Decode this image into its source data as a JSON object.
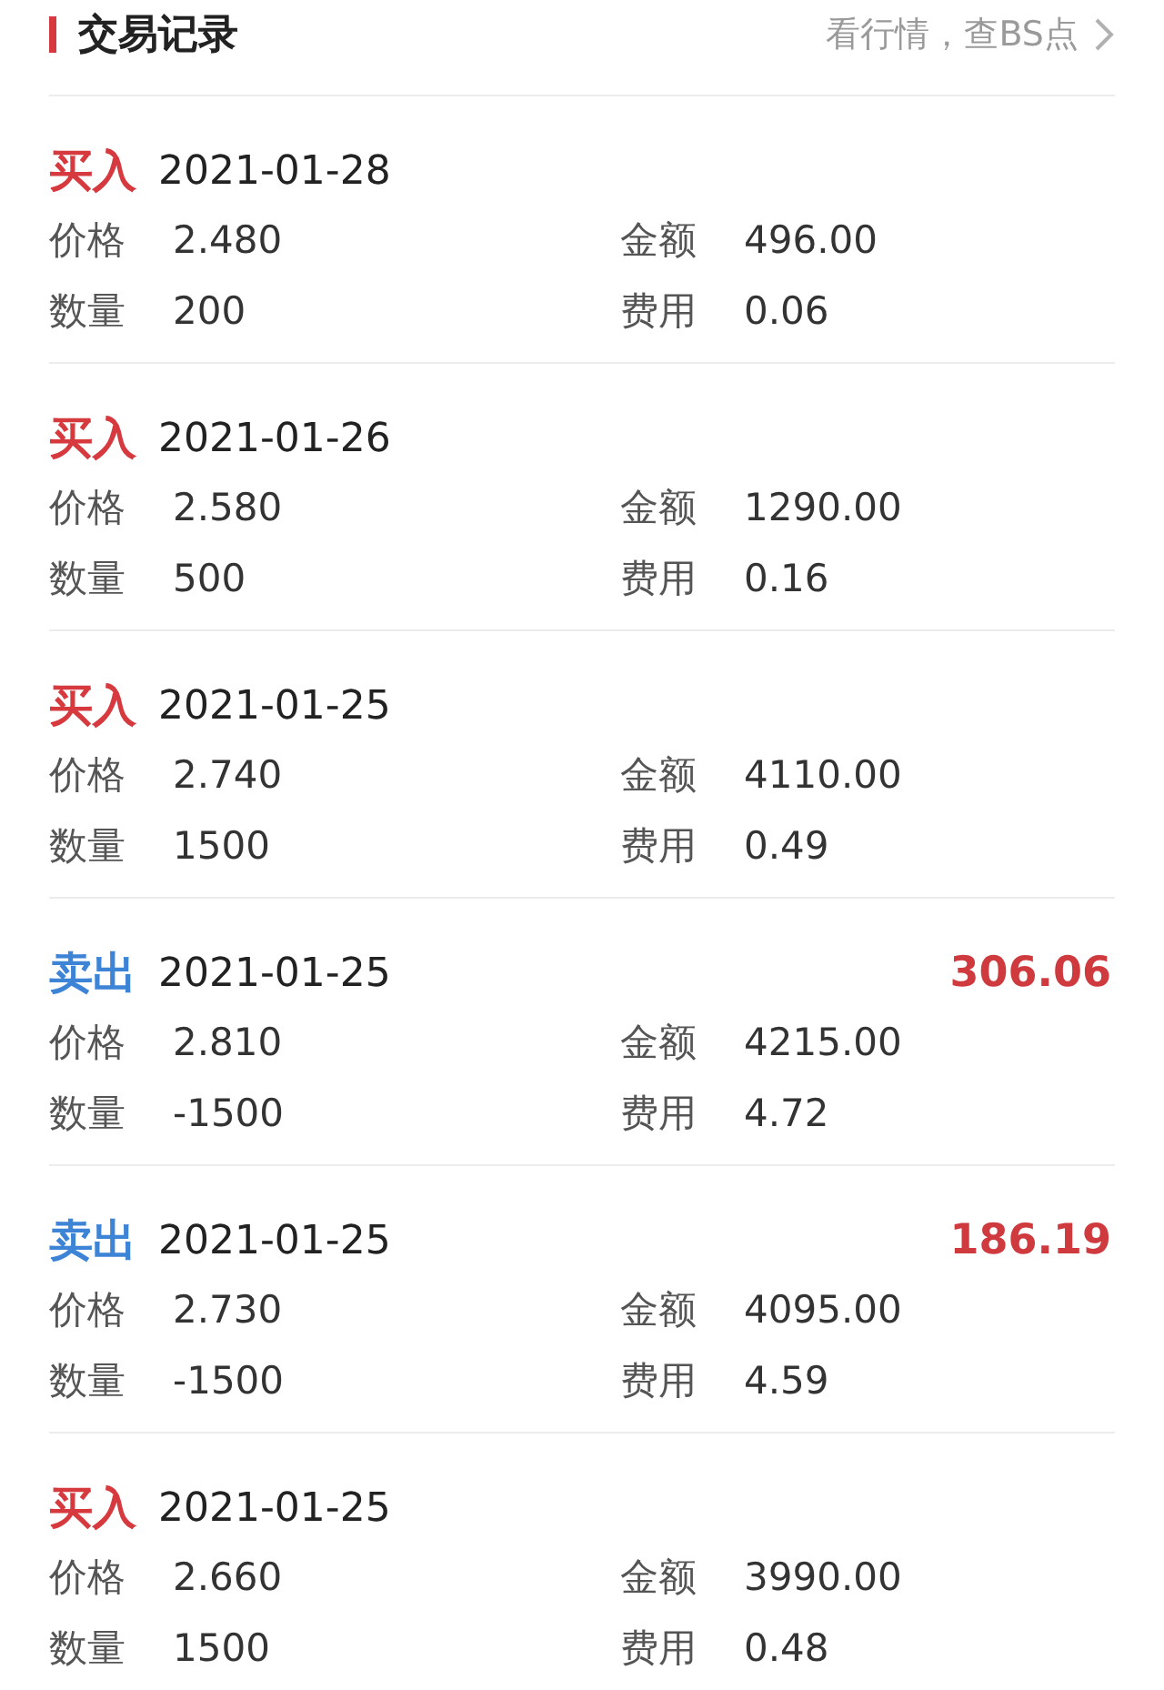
{
  "header": {
    "title": "交易记录",
    "link": "看行情，查BS点"
  },
  "records": [
    {
      "kind": "buy",
      "type": "买入",
      "date": "2021-01-28",
      "rows": [
        [
          {
            "label": "价格",
            "value": "2.480"
          },
          {
            "label": "金额",
            "value": "496.00"
          }
        ],
        [
          {
            "label": "数量",
            "value": "200"
          },
          {
            "label": "费用",
            "value": "0.06"
          }
        ]
      ]
    },
    {
      "kind": "buy",
      "type": "买入",
      "date": "2021-01-26",
      "rows": [
        [
          {
            "label": "价格",
            "value": "2.580"
          },
          {
            "label": "金额",
            "value": "1290.00"
          }
        ],
        [
          {
            "label": "数量",
            "value": "500"
          },
          {
            "label": "费用",
            "value": "0.16"
          }
        ]
      ]
    },
    {
      "kind": "buy",
      "type": "买入",
      "date": "2021-01-25",
      "rows": [
        [
          {
            "label": "价格",
            "value": "2.740"
          },
          {
            "label": "金额",
            "value": "4110.00"
          }
        ],
        [
          {
            "label": "数量",
            "value": "1500"
          },
          {
            "label": "费用",
            "value": "0.49"
          }
        ]
      ]
    },
    {
      "kind": "sell",
      "type": "卖出",
      "date": "2021-01-25",
      "profit": "306.06",
      "rows": [
        [
          {
            "label": "价格",
            "value": "2.810"
          },
          {
            "label": "金额",
            "value": "4215.00"
          }
        ],
        [
          {
            "label": "数量",
            "value": "-1500"
          },
          {
            "label": "费用",
            "value": "4.72"
          }
        ]
      ]
    },
    {
      "kind": "sell",
      "type": "卖出",
      "date": "2021-01-25",
      "profit": "186.19",
      "rows": [
        [
          {
            "label": "价格",
            "value": "2.730"
          },
          {
            "label": "金额",
            "value": "4095.00"
          }
        ],
        [
          {
            "label": "数量",
            "value": "-1500"
          },
          {
            "label": "费用",
            "value": "4.59"
          }
        ]
      ]
    },
    {
      "kind": "buy",
      "type": "买入",
      "date": "2021-01-25",
      "rows": [
        [
          {
            "label": "价格",
            "value": "2.660"
          },
          {
            "label": "金额",
            "value": "3990.00"
          }
        ],
        [
          {
            "label": "数量",
            "value": "1500"
          },
          {
            "label": "费用",
            "value": "0.48"
          }
        ]
      ]
    }
  ]
}
